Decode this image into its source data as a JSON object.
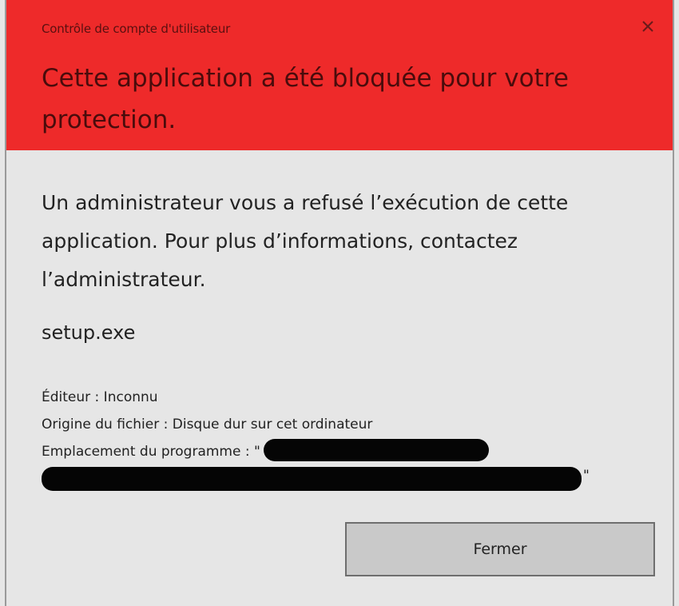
{
  "window": {
    "title": "Contrôle de compte d'utilisateur",
    "heading": "Cette application a été bloquée pour votre protection.",
    "close_icon": "close-icon",
    "header_color": "#ee2a2a"
  },
  "content": {
    "message": "Un administrateur vous a refusé l’exécution de cette application. Pour plus d’informations, contactez l’administrateur.",
    "filename": "setup.exe",
    "publisher": "Éditeur : Inconnu",
    "file_origin": "Origine du fichier : Disque dur sur cet ordinateur",
    "program_location_label": "Emplacement du programme : \"",
    "program_location_end": "\""
  },
  "actions": {
    "close_label": "Fermer"
  }
}
